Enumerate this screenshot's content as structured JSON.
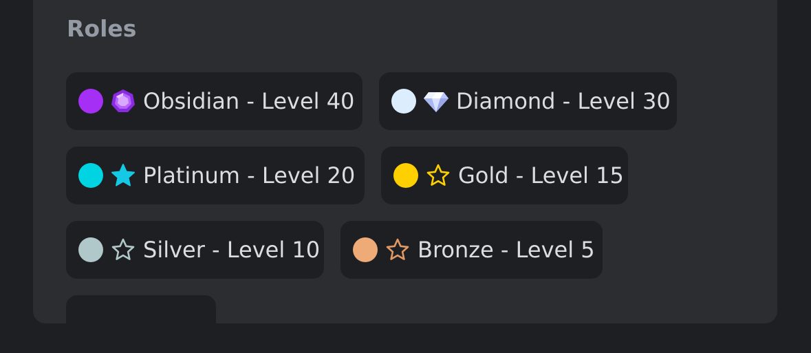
{
  "section": {
    "title": "Roles"
  },
  "roles": [
    {
      "label": "Obsidian - Level 40",
      "color": "#a62ff6",
      "icon": "purple-gem-icon"
    },
    {
      "label": "Diamond - Level 30",
      "color": "#dceefd",
      "icon": "diamond-icon"
    },
    {
      "label": "Platinum - Level 20",
      "color": "#00d4e3",
      "icon": "blue-star-icon"
    },
    {
      "label": "Gold - Level 15",
      "color": "#ffd000",
      "icon": "gold-star-outline-icon"
    },
    {
      "label": "Silver - Level 10",
      "color": "#b1c8cb",
      "icon": "silver-star-outline-icon"
    },
    {
      "label": "Bronze - Level 5",
      "color": "#eeaa77",
      "icon": "bronze-star-outline-icon"
    }
  ]
}
